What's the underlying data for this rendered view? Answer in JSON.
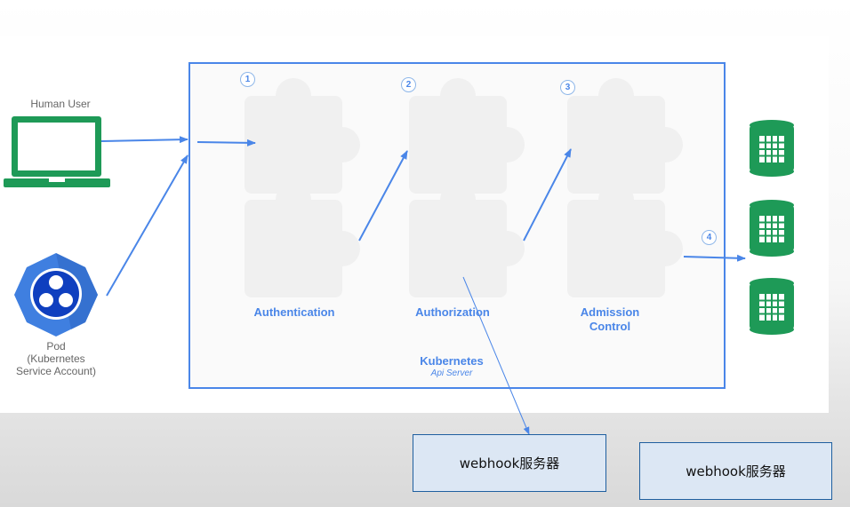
{
  "actors": {
    "human_user_label": "Human User",
    "pod_label_line1": "Pod",
    "pod_label_line2": "(Kubernetes",
    "pod_label_line3": "Service Account)"
  },
  "api_server": {
    "title": "Kubernetes",
    "subtitle": "Api Server"
  },
  "stages": [
    {
      "number": "1",
      "label": "Authentication"
    },
    {
      "number": "2",
      "label": "Authorization"
    },
    {
      "number": "3",
      "label": "Admission",
      "label2": "Control"
    },
    {
      "number": "4"
    }
  ],
  "webhooks": [
    {
      "label": "webhook服务器"
    },
    {
      "label": "webhook服务器"
    }
  ],
  "colors": {
    "accent_blue": "#4a86e8",
    "green": "#1e9a57",
    "puzzle": "#f5f5f5",
    "webhook_fill": "#dce7f4"
  }
}
